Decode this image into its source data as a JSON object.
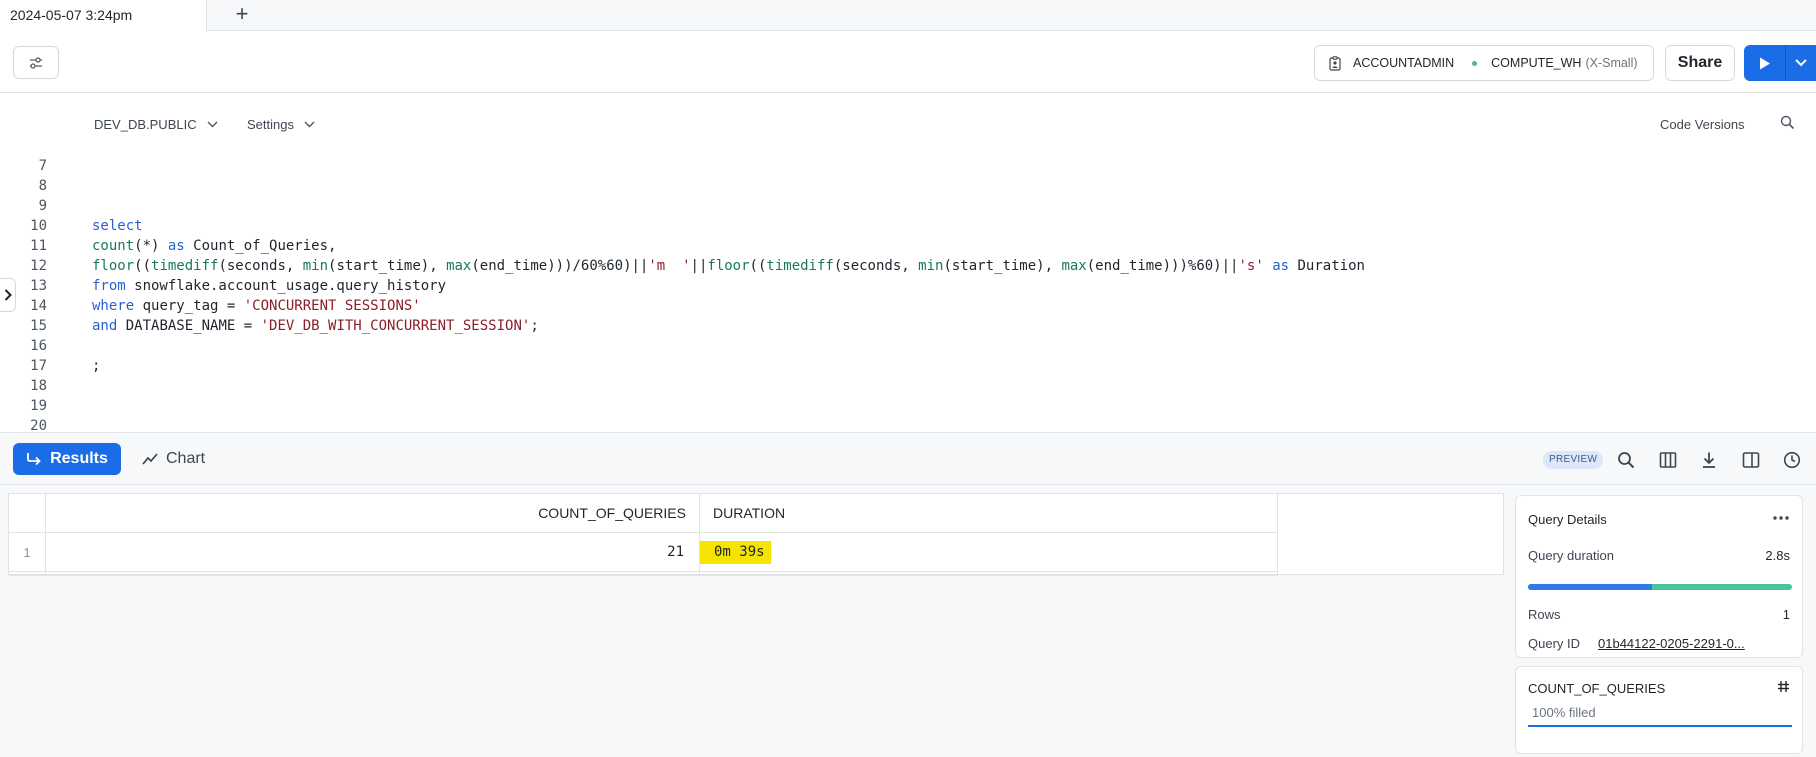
{
  "tab": {
    "title": "2024-05-07 3:24pm",
    "add_symbol": "+"
  },
  "toolbar": {
    "role": "ACCOUNTADMIN",
    "warehouse": "COMPUTE_WH",
    "warehouse_size": "(X-Small)",
    "share_label": "Share"
  },
  "editor_header": {
    "database": "DEV_DB.PUBLIC",
    "settings": "Settings",
    "code_versions": "Code Versions"
  },
  "code_lines": [
    {
      "n": "7",
      "text": ""
    },
    {
      "n": "8",
      "text": ""
    },
    {
      "n": "9",
      "text": ""
    },
    {
      "n": "10",
      "text": "select"
    },
    {
      "n": "11",
      "text": "count(*) as Count_of_Queries,"
    },
    {
      "n": "12",
      "text": "floor((timediff(seconds, min(start_time), max(end_time)))/60%60)||'m  '||floor((timediff(seconds, min(start_time), max(end_time)))%60)||'s' as Duration"
    },
    {
      "n": "13",
      "text": "from snowflake.account_usage.query_history"
    },
    {
      "n": "14",
      "text": "where query_tag = 'CONCURRENT SESSIONS'"
    },
    {
      "n": "15",
      "text": "and DATABASE_NAME = 'DEV_DB_WITH_CONCURRENT_SESSION';"
    },
    {
      "n": "16",
      "text": ""
    },
    {
      "n": "17",
      "text": ";"
    },
    {
      "n": "18",
      "text": ""
    },
    {
      "n": "19",
      "text": ""
    },
    {
      "n": "20",
      "text": ""
    }
  ],
  "results_bar": {
    "results_label": "Results",
    "chart_label": "Chart",
    "preview_badge": "PREVIEW"
  },
  "grid": {
    "columns": [
      "COUNT_OF_QUERIES",
      "DURATION"
    ],
    "rows": [
      {
        "index": "1",
        "count_of_queries": "21",
        "duration": "0m  39s"
      }
    ]
  },
  "query_details": {
    "title": "Query Details",
    "duration_label": "Query duration",
    "duration_value": "2.8s",
    "duration_split_fraction": 0.47,
    "rows_label": "Rows",
    "rows_value": "1",
    "query_id_label": "Query ID",
    "query_id_value": "01b44122-0205-2291-0..."
  },
  "column_card": {
    "title": "COUNT_OF_QUERIES",
    "filled": "100% filled"
  },
  "colors": {
    "accent": "#1a6ce7",
    "highlight": "#f5e400",
    "status_dot": "#3cbf8d"
  }
}
